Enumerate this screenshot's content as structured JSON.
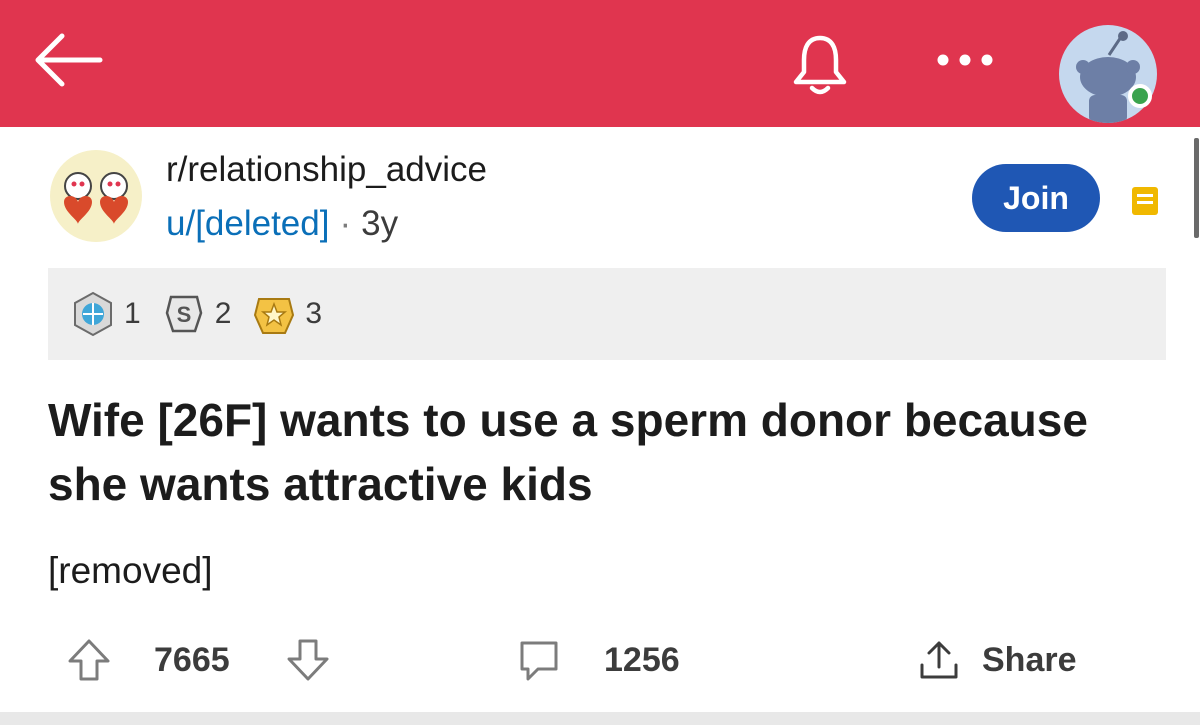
{
  "topbar": {
    "color": "#e0354f",
    "icons": [
      "back-arrow-icon",
      "bell-icon",
      "more-icon",
      "avatar-icon"
    ]
  },
  "post": {
    "subreddit": "r/relationship_advice",
    "author": "u/[deleted]",
    "separator": "·",
    "age": "3y",
    "join_label": "Join",
    "awards": [
      {
        "icon": "globe-award-icon",
        "count": "1"
      },
      {
        "icon": "silver-award-icon",
        "count": "2"
      },
      {
        "icon": "gold-award-icon",
        "count": "3"
      }
    ],
    "title": "Wife [26F] wants to use a sperm donor because she wants attractive kids",
    "body": "[removed]",
    "votes": "7665",
    "comments": "1256",
    "share_label": "Share"
  },
  "colors": {
    "accent": "#e0354f",
    "join": "#1f57b4",
    "link": "#0a6fb8",
    "online": "#3aa34e"
  }
}
